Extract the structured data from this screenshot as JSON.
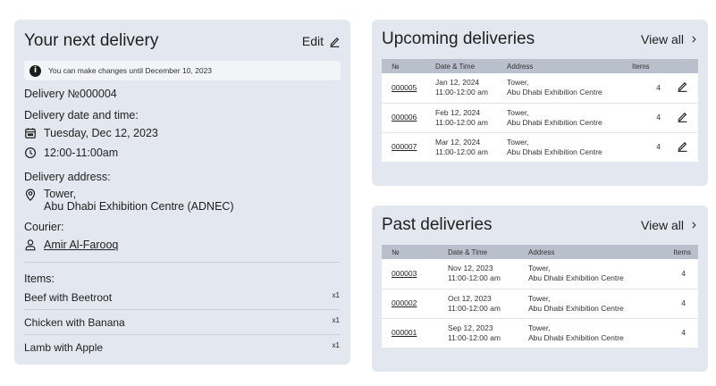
{
  "next_delivery": {
    "title": "Your next delivery",
    "edit_label": "Edit",
    "notice": "You can make changes until December 10, 2023",
    "delivery_number": "Delivery №000004",
    "date_label": "Delivery date and time:",
    "date": "Tuesday, Dec 12, 2023",
    "time": "12:00-11:00am",
    "address_label": "Delivery address:",
    "address_line1": "Tower,",
    "address_line2": "Abu Dhabi Exhibition Centre (ADNEC)",
    "courier_label": "Courier:",
    "courier_name": "Amir Al-Farooq",
    "items_label": "Items:",
    "items": [
      {
        "name": "Beef with Beetroot",
        "qty": "x1"
      },
      {
        "name": "Chicken with Banana",
        "qty": "x1"
      },
      {
        "name": "Lamb with Apple",
        "qty": "x1"
      }
    ]
  },
  "upcoming": {
    "title": "Upcoming deliveries",
    "view_all": "View all",
    "headers": {
      "num": "№",
      "date": "Date & Time",
      "address": "Address",
      "items": "Items"
    },
    "rows": [
      {
        "num": "000005",
        "date": "Jan 12, 2024",
        "time": "11:00-12:00 am",
        "addr1": "Tower,",
        "addr2": "Abu Dhabi Exhibition Centre",
        "items": "4"
      },
      {
        "num": "000006",
        "date": "Feb 12, 2024",
        "time": "11:00-12:00 am",
        "addr1": "Tower,",
        "addr2": "Abu Dhabi Exhibition Centre",
        "items": "4"
      },
      {
        "num": "000007",
        "date": "Mar 12, 2024",
        "time": "11:00-12:00 am",
        "addr1": "Tower,",
        "addr2": "Abu Dhabi Exhibition Centre",
        "items": "4"
      }
    ]
  },
  "past": {
    "title": "Past deliveries",
    "view_all": "View all",
    "headers": {
      "num": "№",
      "date": "Date & Time",
      "address": "Address",
      "items": "Items"
    },
    "rows": [
      {
        "num": "000003",
        "date": "Nov 12, 2023",
        "time": "11:00-12:00 am",
        "addr1": "Tower,",
        "addr2": "Abu Dhabi Exhibition Centre",
        "items": "4"
      },
      {
        "num": "000002",
        "date": "Oct 12, 2023",
        "time": "11:00-12:00 am",
        "addr1": "Tower,",
        "addr2": "Abu Dhabi Exhibition Centre",
        "items": "4"
      },
      {
        "num": "000001",
        "date": "Sep 12, 2023",
        "time": "11:00-12:00 am",
        "addr1": "Tower,",
        "addr2": "Abu Dhabi Exhibition Centre",
        "items": "4"
      }
    ]
  }
}
